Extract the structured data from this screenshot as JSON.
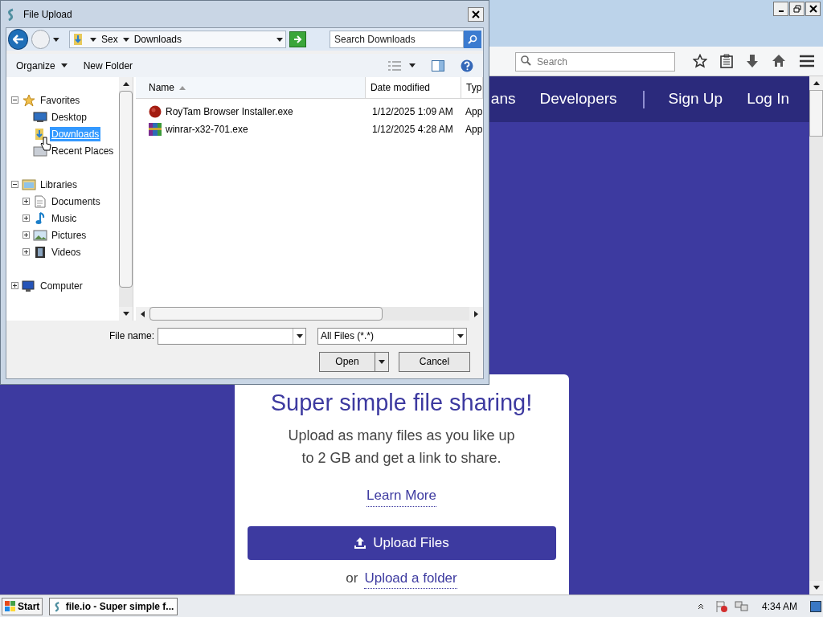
{
  "browser": {
    "search": {
      "placeholder": "Search"
    },
    "site_nav": [
      {
        "kind": "link",
        "label": "ans"
      },
      {
        "kind": "link",
        "label": "Developers"
      },
      {
        "kind": "separator"
      },
      {
        "kind": "link",
        "label": "Sign Up"
      },
      {
        "kind": "link",
        "label": "Log In"
      }
    ],
    "card": {
      "title": "Super simple file sharing!",
      "text": "Upload as many files as you like up to 2 GB and get a link to share.",
      "learn_more": "Learn More",
      "upload_button": "Upload Files",
      "or": "or",
      "folder_link": "Upload a folder"
    }
  },
  "dialog": {
    "title": "File Upload",
    "breadcrumb": [
      "Sex",
      "Downloads"
    ],
    "search": {
      "placeholder": "Search Downloads"
    },
    "toolbar": {
      "organize": "Organize",
      "new_folder": "New Folder"
    },
    "tree": [
      {
        "label": "Favorites",
        "kind": "favorites",
        "expanded": true,
        "selected": false,
        "children": [
          {
            "label": "Desktop",
            "kind": "desktop",
            "selected": false
          },
          {
            "label": "Downloads",
            "kind": "downloads",
            "selected": true
          },
          {
            "label": "Recent Places",
            "kind": "recent",
            "selected": false
          }
        ]
      },
      {
        "label": "Libraries",
        "kind": "libraries",
        "expanded": true,
        "selected": false,
        "children": [
          {
            "label": "Documents",
            "kind": "documents",
            "expanded": false,
            "selected": false
          },
          {
            "label": "Music",
            "kind": "music",
            "expanded": false,
            "selected": false
          },
          {
            "label": "Pictures",
            "kind": "pictures",
            "expanded": false,
            "selected": false
          },
          {
            "label": "Videos",
            "kind": "videos",
            "expanded": false,
            "selected": false
          }
        ]
      },
      {
        "label": "Computer",
        "kind": "computer",
        "expanded": false,
        "selected": false
      }
    ],
    "columns": [
      {
        "label": "Name",
        "sorted": true
      },
      {
        "label": "Date modified",
        "sorted": false
      },
      {
        "label": "Typ",
        "sorted": false
      }
    ],
    "files": [
      {
        "name": "RoyTam Browser Installer.exe",
        "date": "1/12/2025 1:09 AM",
        "type": "App",
        "kind": "browser"
      },
      {
        "name": "winrar-x32-701.exe",
        "date": "1/12/2025 4:28 AM",
        "type": "App",
        "kind": "archive"
      }
    ],
    "file_name_label": "File name:",
    "filter": "All Files (*.*)",
    "open": "Open",
    "cancel": "Cancel"
  },
  "taskbar": {
    "start": "Start",
    "tasks": [
      {
        "label": "file.io - Super simple f...",
        "selected": true
      }
    ],
    "clock": "4:34 AM"
  }
}
